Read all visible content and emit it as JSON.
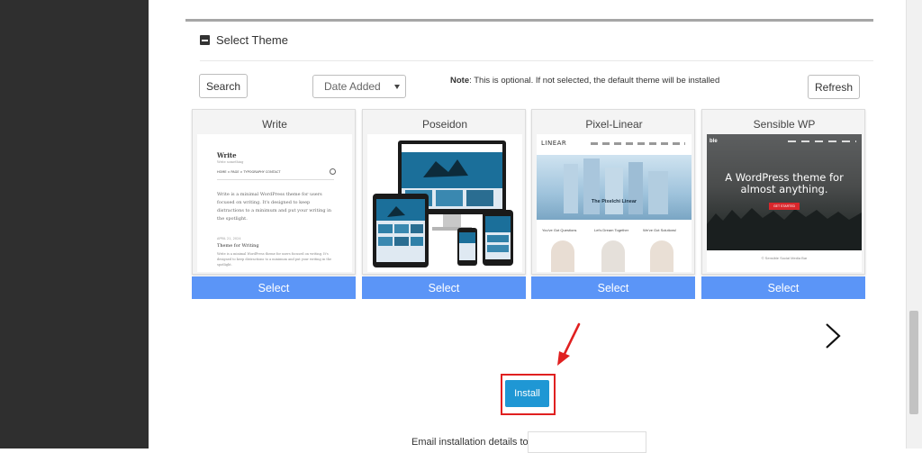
{
  "section": {
    "title": "Select Theme"
  },
  "toolbar": {
    "search_label": "Search",
    "sort_value": "Date Added",
    "note_bold": "Note",
    "note_text": ": This is optional. If not selected, the default theme will be installed",
    "refresh_label": "Refresh"
  },
  "themes": [
    {
      "name": "Write",
      "select_label": "Select",
      "preview": {
        "site_title": "Write",
        "tagline": "Write something",
        "nav": "HOME ∨   PAGE ∨   TYPOGRAPHY   CONTACT",
        "body": "Write is a minimal WordPress theme for users focused on writing. It's designed to keep distractions to a minimum and put your writing in the spotlight.",
        "post_date": "APRIL 21, 2024",
        "post_title": "Theme for Writing",
        "post_body": "Write is a minimal WordPress theme for users focused on writing. It's designed to keep distractions to a minimum and put your writing in the spotlight."
      }
    },
    {
      "name": "Poseidon",
      "select_label": "Select"
    },
    {
      "name": "Pixel-Linear",
      "select_label": "Select",
      "preview": {
        "logo": "LINEAR",
        "hero": "The Pixelchi Linear",
        "col1": "You've Got Questions",
        "col2": "Let's Dream Together",
        "col3": "We've Got Solutions!"
      }
    },
    {
      "name": "Sensible WP",
      "select_label": "Select",
      "preview": {
        "brand": "ble",
        "headline": "A WordPress theme for almost anything.",
        "cta": "GET STARTED",
        "footer": "© Sensible Social Media Bar"
      }
    }
  ],
  "install": {
    "label": "Install"
  },
  "email": {
    "label": "Email installation details to :",
    "value": ""
  },
  "colors": {
    "select_button": "#5b95f7",
    "install_button": "#1f97d4",
    "highlight": "#e02020"
  }
}
